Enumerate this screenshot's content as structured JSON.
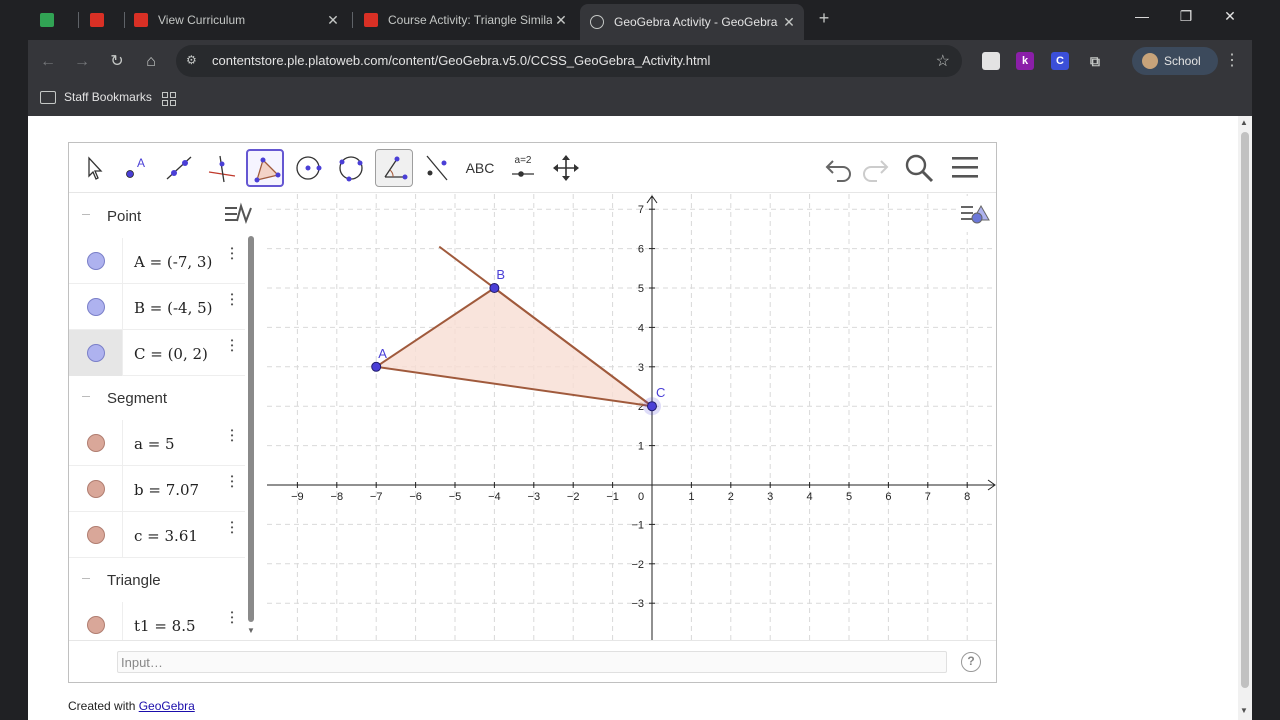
{
  "browser": {
    "tabs": [
      {
        "title": "",
        "favicon_color": "#31a354",
        "active": false
      },
      {
        "title": "",
        "favicon_color": "#d93025",
        "active": false
      },
      {
        "title": "View Curriculum",
        "favicon_color": "#d93025",
        "active": false
      },
      {
        "title": "Course Activity: Triangle Similar",
        "favicon_color": "#d93025",
        "active": false
      },
      {
        "title": "GeoGebra Activity - GeoGebra I",
        "favicon_color": "#9aa0a6",
        "active": true
      }
    ],
    "new_tab_glyph": "+",
    "url": "contentstore.ple.platoweb.com/content/GeoGebra.v5.0/CCSS_GeoGebra_Activity.html",
    "extensions": [
      {
        "label": "",
        "color": "#e3e3e3",
        "text_color": "#202124"
      },
      {
        "label": "k",
        "color": "#8b1fa9",
        "text_color": "#ffffff"
      },
      {
        "label": "C",
        "color": "#3b4fd8",
        "text_color": "#ffffff"
      }
    ],
    "profile_label": "School",
    "bookmarks": {
      "folder_label": "Staff Bookmarks"
    }
  },
  "ggb": {
    "toolbar": {
      "text_tool_label": "ABC",
      "slider_tool_label": "a=2"
    },
    "algebra": {
      "groups": [
        {
          "label": "Point",
          "items": [
            {
              "expr": "A = (-7, 3)",
              "color": "#aeb2ef",
              "selected": false
            },
            {
              "expr": "B = (-4, 5)",
              "color": "#aeb2ef",
              "selected": false
            },
            {
              "expr": "C = (0, 2)",
              "color": "#aeb2ef",
              "selected": true
            }
          ]
        },
        {
          "label": "Segment",
          "items": [
            {
              "expr": "a = 5",
              "color": "#d9a799",
              "selected": false
            },
            {
              "expr": "b = 7.07",
              "color": "#d9a799",
              "selected": false
            },
            {
              "expr": "c = 3.61",
              "color": "#d9a799",
              "selected": false
            }
          ]
        },
        {
          "label": "Triangle",
          "items": [
            {
              "expr": "t1 = 8.5",
              "color": "#d9a799",
              "selected": false
            }
          ]
        }
      ]
    },
    "graphics": {
      "x_ticks": [
        "−9",
        "−8",
        "−7",
        "−6",
        "−5",
        "−4",
        "−3",
        "−2",
        "−1",
        "0",
        "1",
        "2",
        "3",
        "4",
        "5",
        "6",
        "7",
        "8"
      ],
      "y_ticks": [
        "7",
        "6",
        "5",
        "4",
        "3",
        "2",
        "1",
        "−1",
        "−2",
        "−3"
      ],
      "points": [
        {
          "label": "A",
          "x": -7,
          "y": 3
        },
        {
          "label": "B",
          "x": -4,
          "y": 5
        },
        {
          "label": "C",
          "x": 0,
          "y": 2
        }
      ],
      "extra_line_through": {
        "from": "C",
        "to": "B"
      },
      "point_color": "#4a3fd6",
      "segment_color": "#a05a3c",
      "fill_color": "#f7ddd3"
    },
    "input_placeholder": "Input…",
    "help_glyph": "?"
  },
  "credit": {
    "prefix": "Created with ",
    "link": "GeoGebra"
  }
}
